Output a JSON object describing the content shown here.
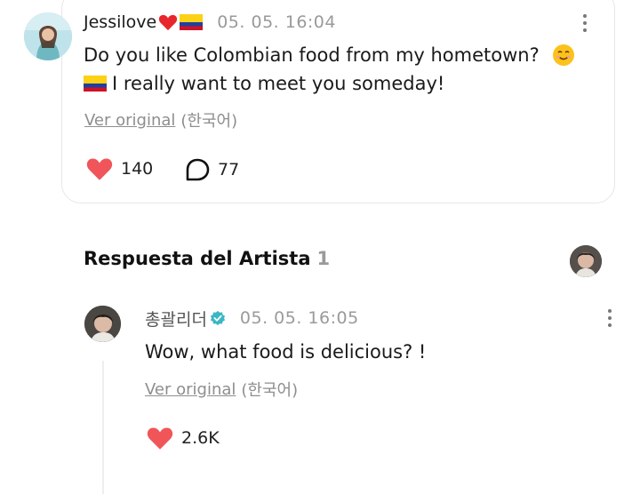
{
  "fan_comment": {
    "username": "Jessilove",
    "timestamp": "05. 05. 16:04",
    "text_line1": "Do you like Colombian food from my hometown?",
    "text_line2": "I really want to meet you someday!",
    "ver_original": "Ver original",
    "language": "(한국어)",
    "likes": "140",
    "replies": "77",
    "icons": [
      "heart-emoji-icon",
      "colombia-flag-icon",
      "smiling-face-emoji-icon",
      "heart-icon",
      "comment-bubble-icon",
      "kebab-menu-icon"
    ]
  },
  "artist_section": {
    "title": "Respuesta del Artista",
    "count": "1"
  },
  "artist_reply": {
    "username": "총괄리더",
    "timestamp": "05. 05. 16:05",
    "text": "Wow,  what food is delicious? !",
    "ver_original": "Ver original",
    "language": "(한국어)",
    "likes": "2.6K",
    "icons": [
      "verified-badge-icon",
      "heart-icon",
      "kebab-menu-icon"
    ]
  },
  "colors": {
    "heart": "#f0555a",
    "verified": "#3bb6c4",
    "muted_text": "#9a9a9a",
    "card_border": "#e7e7e7"
  }
}
